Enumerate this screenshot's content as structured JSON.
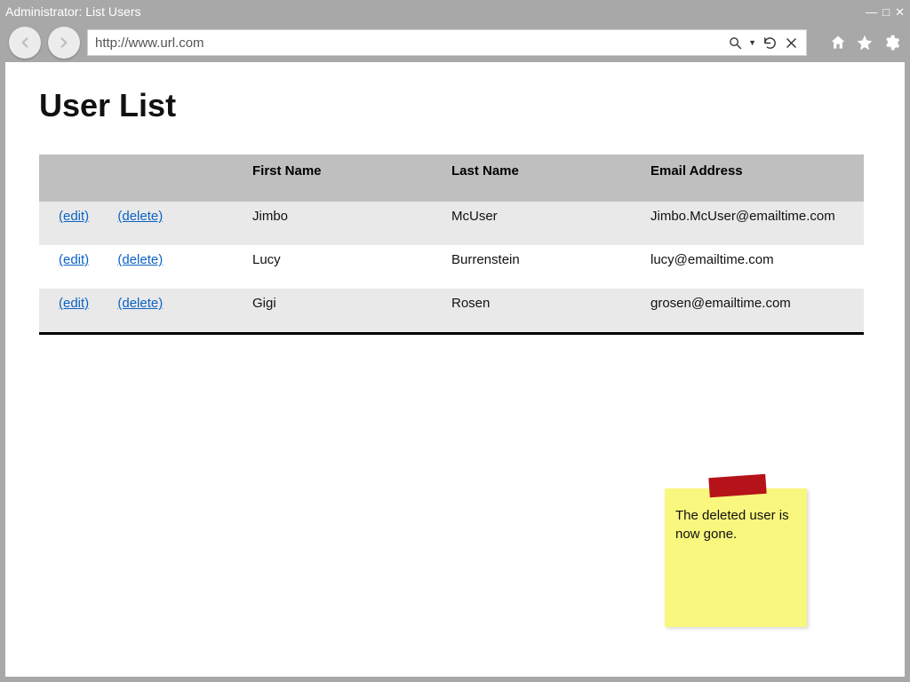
{
  "window": {
    "title": "Administrator: List Users"
  },
  "address": {
    "url": "http://www.url.com"
  },
  "page": {
    "heading": "User List"
  },
  "table": {
    "headers": {
      "actions": "",
      "first": "First Name",
      "last": "Last Name",
      "email": "Email Address"
    },
    "edit_label": "(edit)",
    "delete_label": "(delete)",
    "rows": [
      {
        "first": "Jimbo",
        "last": "McUser",
        "email": "Jimbo.McUser@emailtime.com"
      },
      {
        "first": "Lucy",
        "last": "Burrenstein",
        "email": "lucy@emailtime.com"
      },
      {
        "first": "Gigi",
        "last": "Rosen",
        "email": "grosen@emailtime.com"
      }
    ]
  },
  "note": {
    "text": "The deleted user is now gone."
  }
}
